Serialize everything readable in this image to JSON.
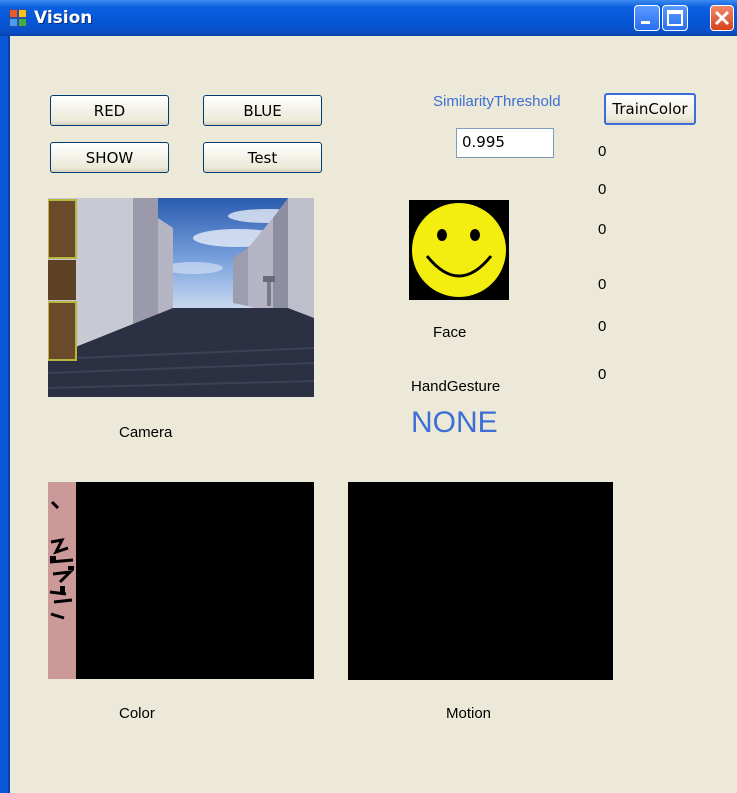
{
  "window": {
    "title": "Vision"
  },
  "buttons": {
    "red": "RED",
    "blue": "BLUE",
    "show": "SHOW",
    "test": "Test",
    "train_color": "TrainColor"
  },
  "similarity": {
    "label": "SimilarityThreshold",
    "value": "0.995"
  },
  "counters": [
    "0",
    "0",
    "0",
    "0",
    "0",
    "0"
  ],
  "labels": {
    "camera": "Camera",
    "face": "Face",
    "hand_gesture": "HandGesture",
    "color": "Color",
    "motion": "Motion"
  },
  "gesture": {
    "value": "NONE"
  },
  "colors": {
    "accent_blue": "#3b6fd6",
    "titlebar": "#0556d6",
    "window_bg": "#ece9d8"
  }
}
